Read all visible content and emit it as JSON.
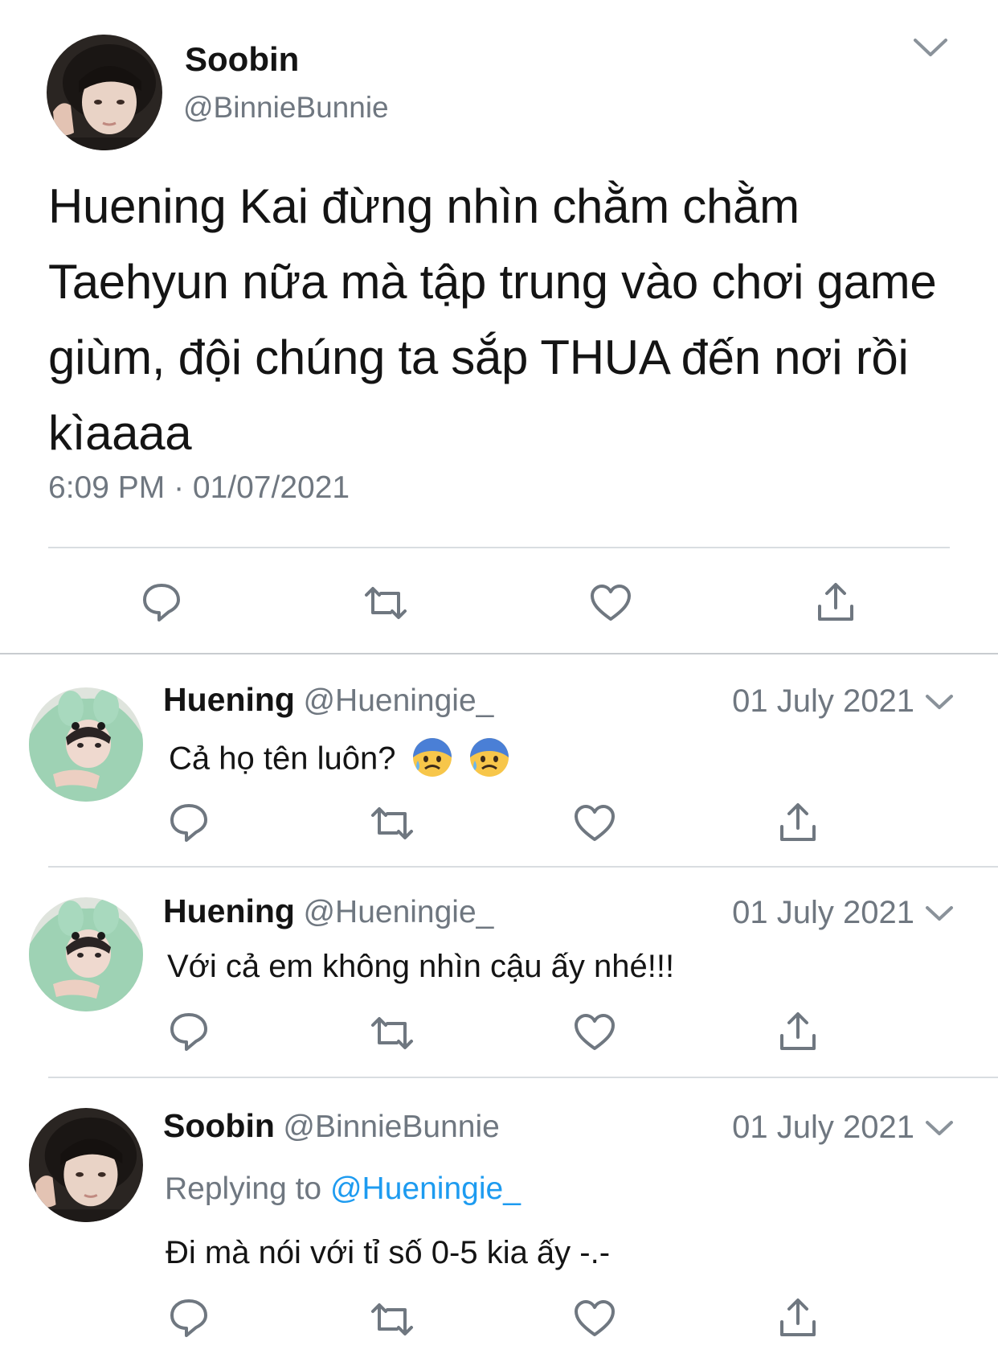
{
  "main_tweet": {
    "name": "Soobin",
    "handle": "@BinnieBunnie",
    "text": "Huening Kai đừng nhìn chằm chằm Taehyun nữa mà tập trung vào chơi game giùm, đội chúng ta sắp THUA đến nơi rồi kìaaaa",
    "timestamp": "6:09 PM · 01/07/2021",
    "avatar_icon": "avatar-soobin",
    "menu_icon": "chevron-down-icon"
  },
  "actions": [
    "reply-icon",
    "retweet-icon",
    "like-icon",
    "share-icon"
  ],
  "replies": [
    {
      "name": "Huening",
      "handle": "@Hueningie_",
      "date": "01 July 2021",
      "text": "Cả họ tên luôn?",
      "emojis": [
        "anxious-face-icon",
        "anxious-face-icon"
      ]
    },
    {
      "name": "Huening",
      "handle": "@Hueningie_",
      "date": "01 July 2021",
      "text": "Với cả em không nhìn cậu ấy nhé!!!"
    },
    {
      "name": "Soobin",
      "handle": "@BinnieBunnie",
      "date": "01 July 2021",
      "replying_prefix": "Replying to",
      "replying_to": "@Hueningie_",
      "text": "Đi mà nói với tỉ số 0-5 kia ấy -.-"
    }
  ],
  "colors": {
    "text": "#141414",
    "secondary": "#6f7780",
    "link": "#1d9bf0",
    "divider": "#d9dde1"
  }
}
